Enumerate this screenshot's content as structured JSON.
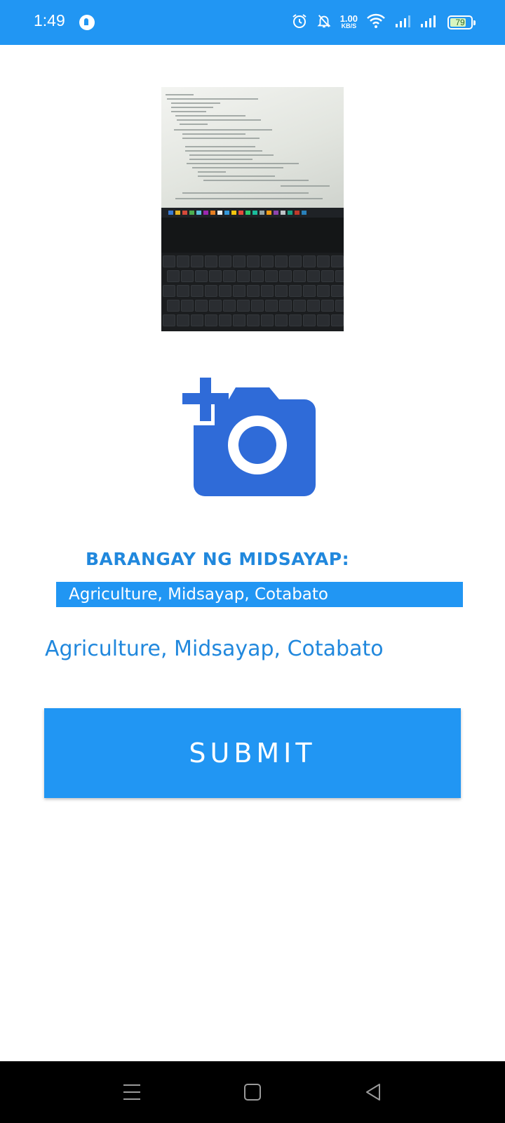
{
  "status_bar": {
    "time": "1:49",
    "net_speed_value": "1.00",
    "net_speed_unit": "KB/S",
    "battery": "79",
    "battery_level": 0.79,
    "background_color": "#2196F3"
  },
  "content": {
    "photo_preview_icon": "laptop-photo",
    "add_photo_icon": "add-a-photo-icon",
    "barangay_label": "BARANGAY NG MIDSAYAP:",
    "spinner_selected": "Agriculture, Midsayap, Cotabato",
    "selected_text": "Agriculture, Midsayap, Cotabato",
    "submit_label": "SUBMIT",
    "accent_color": "#2196F3",
    "text_color": "#2188dd"
  },
  "nav_bar": {
    "items": [
      "menu-icon",
      "home-square-icon",
      "back-triangle-icon"
    ]
  }
}
